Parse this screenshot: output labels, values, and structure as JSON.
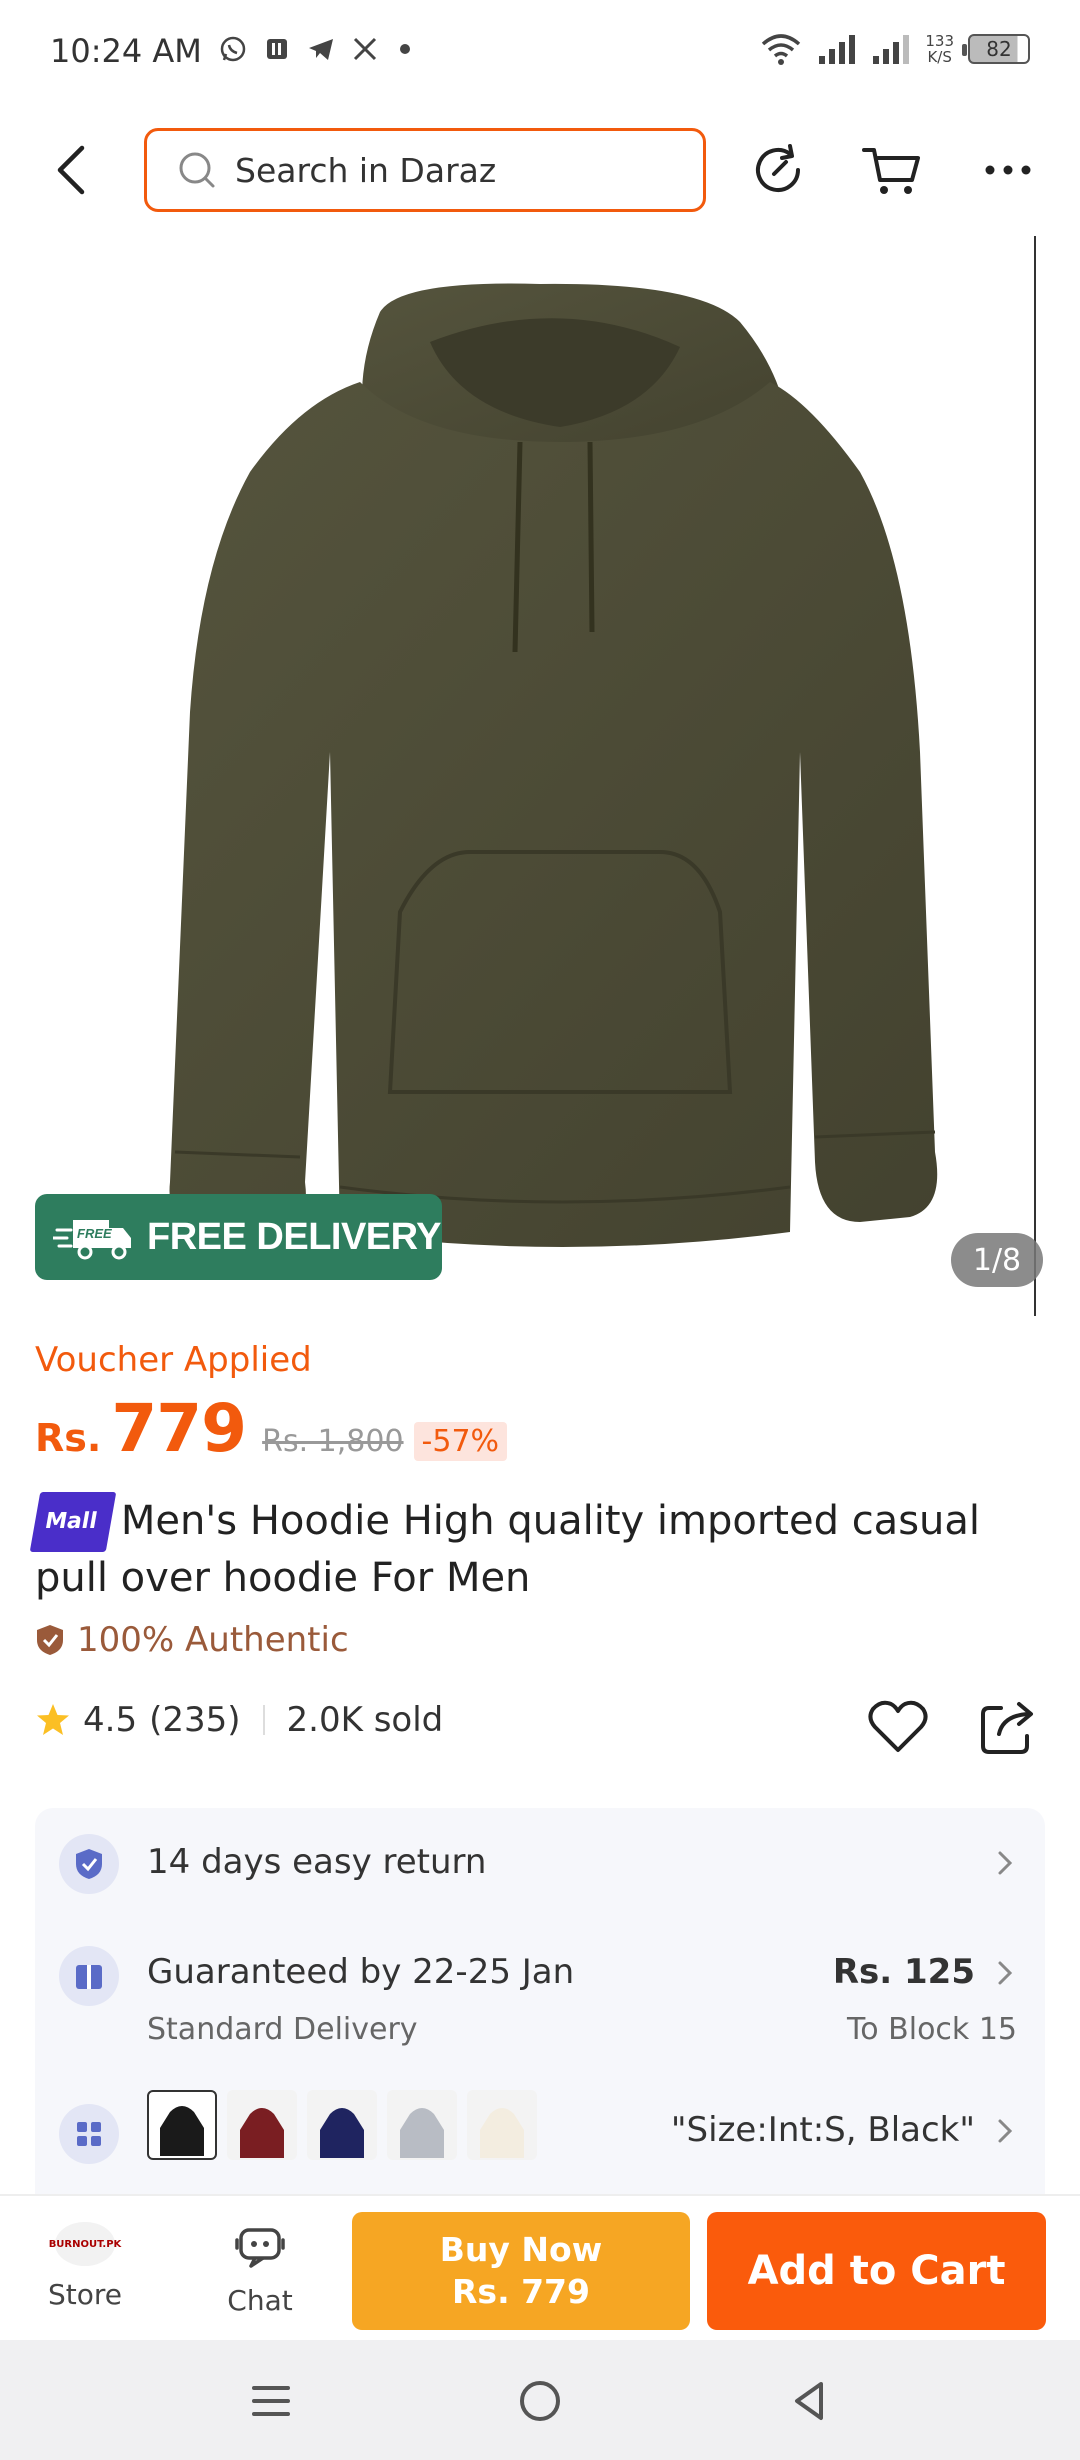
{
  "status_bar": {
    "time": "10:24 AM",
    "app_icons": [
      "whatsapp-icon",
      "app-icon",
      "telegram-icon",
      "x-icon"
    ],
    "network_speed_value": "133",
    "network_speed_unit": "K/S",
    "battery": "82"
  },
  "nav": {
    "search_placeholder": "Search in Daraz"
  },
  "gallery": {
    "product_color": "#4b4a36",
    "free_delivery_badge_small": "FREE",
    "free_delivery_badge": "FREE DELIVERY",
    "image_counter": "1/8"
  },
  "price": {
    "voucher_label": "Voucher Applied",
    "currency": "Rs.",
    "current": "779",
    "original": "Rs. 1,800",
    "discount": "-57%"
  },
  "product": {
    "mall_tag": "Mall",
    "title": "Men's Hoodie High quality imported casual pull over  hoodie For Men",
    "authentic_label": "100% Authentic",
    "rating": "4.5",
    "review_count": "(235)",
    "sold": "2.0K sold"
  },
  "info": {
    "return_policy": "14 days easy return",
    "delivery_guarantee": "Guaranteed by 22-25 Jan",
    "delivery_type": "Standard Delivery",
    "delivery_fee": "Rs. 125",
    "delivery_location": "To Block 15",
    "selected_variant": "\"Size:Int:S, Black\"",
    "variant_colors": [
      "#1a1a1a",
      "#7a1e22",
      "#1f2460",
      "#b8bcc4",
      "#f3ede0"
    ]
  },
  "actions": {
    "store_logo_text": "BURNOUT.PK",
    "store_label": "Store",
    "chat_label": "Chat",
    "buy_now_label": "Buy Now",
    "buy_now_price": "Rs. 779",
    "add_to_cart_label": "Add to Cart"
  },
  "colors": {
    "accent": "#f25a0d",
    "buy_now": "#f6a623",
    "add_to_cart": "#fa5b0c",
    "free_delivery_badge": "#2e7d5e",
    "mall_tag": "#4a2ec9"
  }
}
